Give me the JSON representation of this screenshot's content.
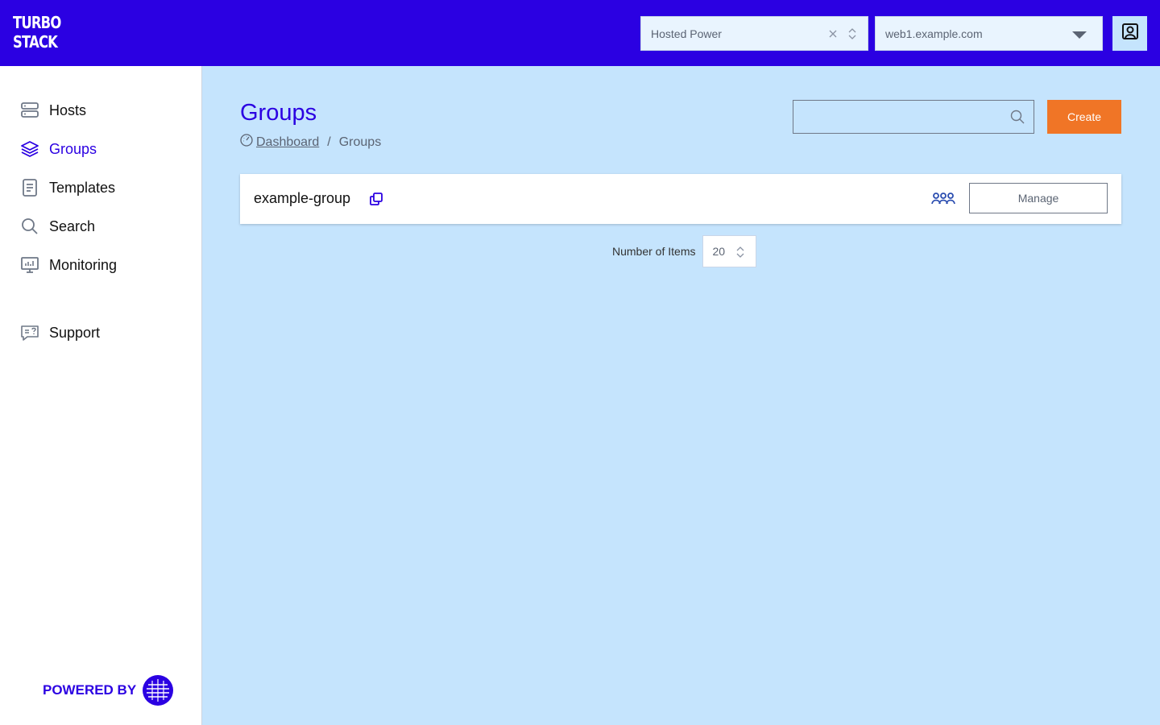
{
  "brand": {
    "logo_line1": "TURBO",
    "logo_line2": "STACK"
  },
  "header": {
    "org_select": {
      "value": "Hosted Power",
      "clear_icon": "x-icon",
      "toggle_icon": "updown-chevron-icon"
    },
    "host_select": {
      "value": "web1.example.com",
      "toggle_icon": "caret-down-icon"
    },
    "user_icon": "user-profile-icon"
  },
  "sidebar": {
    "items": [
      {
        "label": "Hosts",
        "icon": "server-icon",
        "active": false
      },
      {
        "label": "Groups",
        "icon": "layers-icon",
        "active": true
      },
      {
        "label": "Templates",
        "icon": "document-icon",
        "active": false
      },
      {
        "label": "Search",
        "icon": "search-icon",
        "active": false
      },
      {
        "label": "Monitoring",
        "icon": "monitor-icon",
        "active": false
      },
      {
        "label": "Support",
        "icon": "chat-question-icon",
        "active": false
      }
    ],
    "powered_by": "POWERED BY",
    "powered_logo_icon": "hosted-power-logo"
  },
  "main": {
    "title": "Groups",
    "breadcrumb": {
      "home_icon": "dashboard-icon",
      "link": "Dashboard",
      "separator": "/",
      "current": "Groups"
    },
    "search": {
      "placeholder": "",
      "value": "",
      "icon": "search-icon"
    },
    "create_label": "Create",
    "groups": [
      {
        "name": "example-group",
        "copy_icon": "copy-icon",
        "members_icon": "members-icon",
        "manage_label": "Manage"
      }
    ],
    "pagination": {
      "label": "Number of Items",
      "value": "20"
    }
  },
  "colors": {
    "brand": "#2b00e2",
    "accent": "#f07526",
    "background": "#c5e4fd"
  }
}
